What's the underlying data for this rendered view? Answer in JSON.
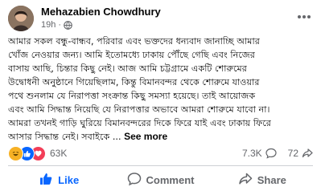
{
  "post": {
    "author_name": "Mehazabien Chowdhury",
    "timestamp": "19h",
    "separator": "·",
    "audience_icon": "globe-icon",
    "more_icon": "ellipsis-icon",
    "lines": [
      "আমার সকল বন্ধু-বান্ধব, পরিবার এবং ভক্তদের ধন্যবাদ জানাচ্ছি আমার",
      "খোঁজ নেওয়ার জন্য। আমি ইতোমধ্যে ঢাকায় পৌঁছে গেছি এবং নিজের",
      "বাসায় আছি, চিন্তার কিছু নেই। আজ আমি চট্টগ্রামে একটি শোরুমের",
      "উদ্বোধনী অনুষ্ঠানে গিয়েছিলাম, কিন্তু বিমানবন্দর থেকে শোরুমে যাওয়ার",
      "পথে শুনলাম যে নিরাপত্তা সংক্রান্ত কিছু সমস্যা হয়েছে। তাই আয়োজক",
      "এবং আমি সিদ্ধান্ত নিয়েছি যে নিরাপত্তার অভাবে আমরা শোরুমে যাবো না।",
      "আমরা তখনই গাড়ি ঘুরিয়ে বিমানবন্দরের দিকে ফিরে যাই এবং ঢাকায় ফিরে"
    ],
    "last_line": "আসার সিদ্ধান্ত নেই। সবাইকে ...",
    "see_more": "See more"
  },
  "reactions": {
    "icons": [
      "haha-icon",
      "like-icon",
      "love-icon"
    ],
    "count": "63K",
    "comments_count": "7.3K",
    "shares_count": "72",
    "comment_icon": "comment-bubble-icon",
    "share_icon": "share-arrow-icon"
  },
  "actions": {
    "like_label": "Like",
    "comment_label": "Comment",
    "share_label": "Share"
  },
  "colors": {
    "like_blue": "#0866ff",
    "love_red": "#f33e58",
    "haha_yellow": "#f7b125",
    "secondary_text": "#65676b"
  }
}
